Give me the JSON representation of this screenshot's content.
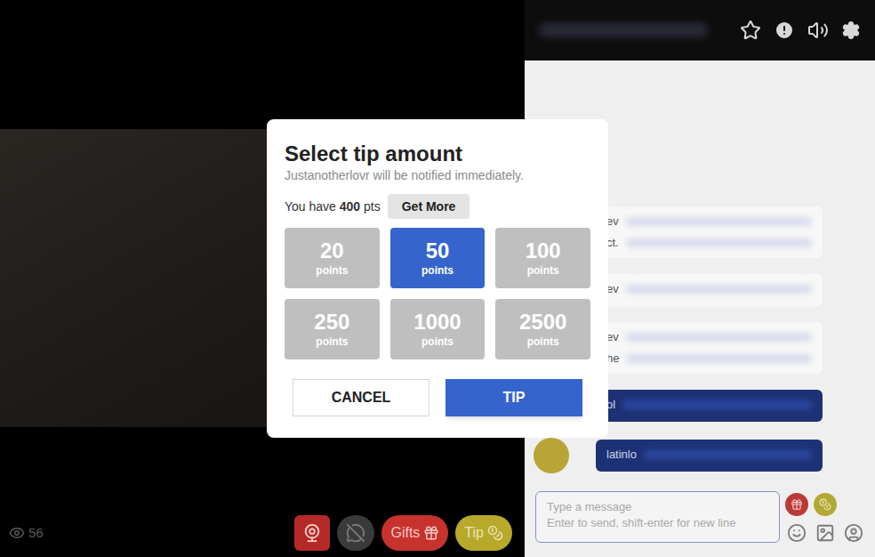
{
  "dialog": {
    "title": "Select tip amount",
    "subtitle": "Justanotherlovr will be notified immediately.",
    "balance_prefix": "You have",
    "balance": "400",
    "balance_unit": "pts",
    "get_more": "Get More",
    "options": [
      {
        "amount": "20",
        "unit": "points",
        "selected": false
      },
      {
        "amount": "50",
        "unit": "points",
        "selected": true
      },
      {
        "amount": "100",
        "unit": "points",
        "selected": false
      },
      {
        "amount": "250",
        "unit": "points",
        "selected": false
      },
      {
        "amount": "1000",
        "unit": "points",
        "selected": false
      },
      {
        "amount": "2500",
        "unit": "points",
        "selected": false
      }
    ],
    "buttons": {
      "cancel": "CANCEL",
      "tip": "TIP"
    }
  },
  "viewer_count": "56",
  "controls": [
    {
      "label": "Gifts",
      "color": "#c8322d"
    },
    {
      "label": "Tip",
      "color": "#b9a92a"
    }
  ],
  "chat": {
    "messages": [
      {
        "kind": "plain",
        "lines": [
          "ev",
          "ct."
        ]
      },
      {
        "kind": "plain",
        "lines": [
          "ev"
        ]
      },
      {
        "kind": "plain",
        "lines": [
          "ev",
          "he"
        ]
      },
      {
        "kind": "highlight",
        "lines": [
          "ol"
        ]
      },
      {
        "kind": "highlight",
        "lines": [
          "latinlo"
        ]
      }
    ],
    "input_placeholder": "Type a message",
    "input_hint": "Enter to send, shift-enter for new line"
  }
}
